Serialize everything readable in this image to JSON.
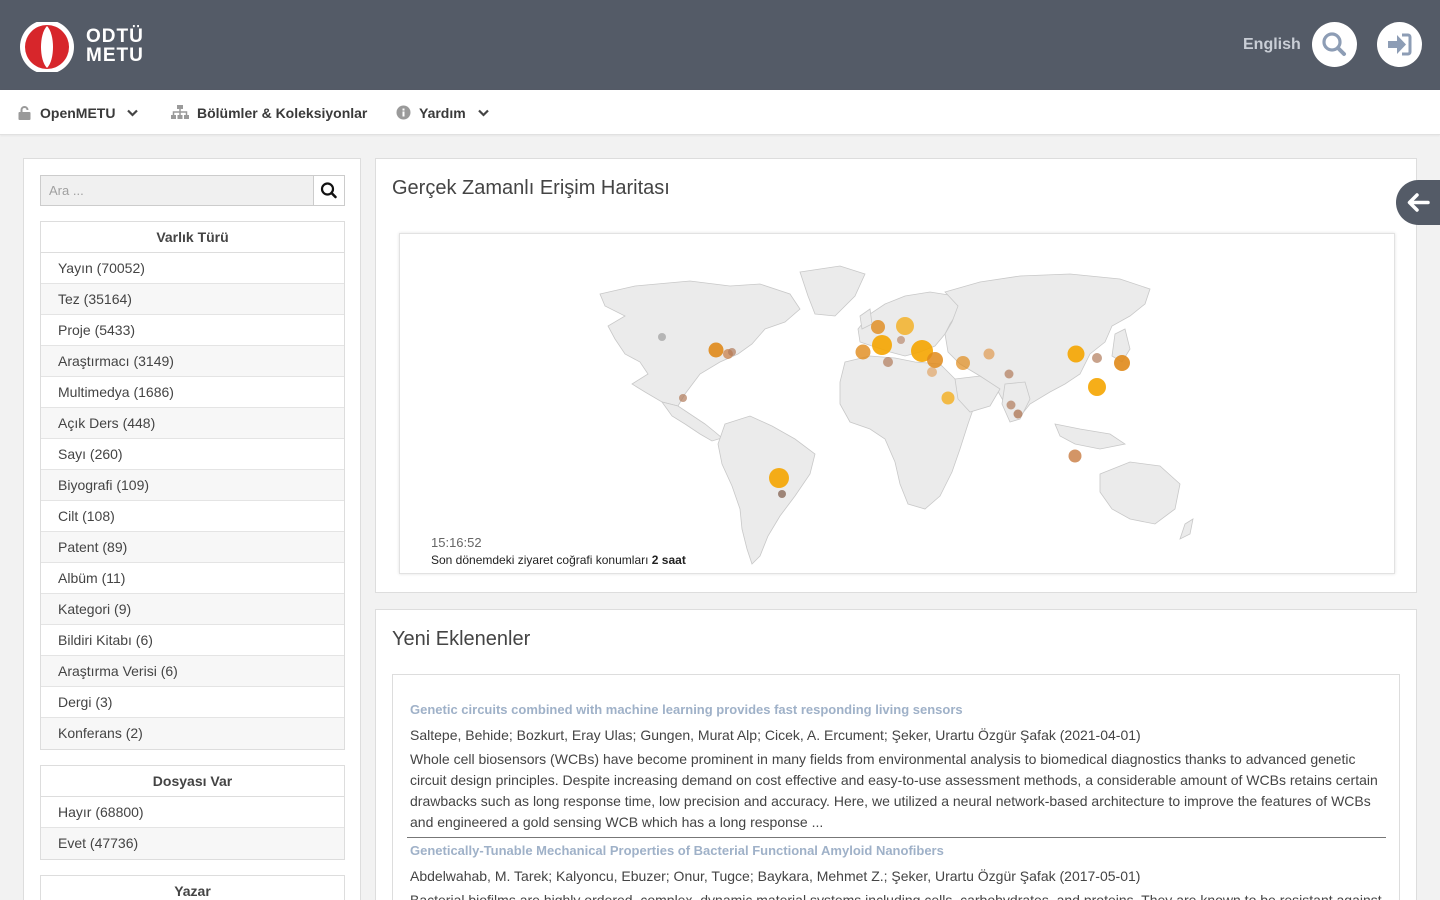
{
  "header": {
    "logo_line1": "ODTÜ",
    "logo_line2": "METU",
    "language_link": "English"
  },
  "nav": [
    {
      "label": "OpenMETU",
      "icon": "lock-icon",
      "has_dropdown": true
    },
    {
      "label": "Bölümler & Koleksiyonlar",
      "icon": "sitemap-icon",
      "has_dropdown": false
    },
    {
      "label": "Yardım",
      "icon": "info-icon",
      "has_dropdown": true
    }
  ],
  "sidebar": {
    "search_placeholder": "Ara ...",
    "facets": [
      {
        "title": "Varlık Türü",
        "items": [
          "Yayın (70052)",
          "Tez (35164)",
          "Proje (5433)",
          "Araştırmacı (3149)",
          "Multimedya (1686)",
          "Açık Ders (448)",
          "Sayı (260)",
          "Biyografi (109)",
          "Cilt (108)",
          "Patent (89)",
          "Albüm (11)",
          "Kategori (9)",
          "Bildiri Kitabı (6)",
          "Araştırma Verisi (6)",
          "Dergi (3)",
          "Konferans (2)"
        ]
      },
      {
        "title": "Dosyası Var",
        "items": [
          "Hayır (68800)",
          "Evet (47736)"
        ]
      },
      {
        "title": "Yazar",
        "items": []
      }
    ]
  },
  "map_panel": {
    "title": "Gerçek Zamanlı Erişim Haritası",
    "time": "15:16:52",
    "caption_prefix": "Son dönemdeki ziyaret coğrafi konumları",
    "caption_bold": "2 saat"
  },
  "recent_panel": {
    "title": "Yeni Eklenenler",
    "items": [
      {
        "title": "Genetic circuits combined with machine learning provides fast responding living sensors",
        "authors": "Saltepe, Behide; Bozkurt, Eray Ulas; Gungen, Murat Alp; Cicek, A. Ercument; Şeker, Urartu Özgür Şafak (2021-04-01)",
        "abstract": "Whole cell biosensors (WCBs) have become prominent in many fields from environmental analysis to biomedical diagnostics thanks to advanced genetic circuit design principles. Despite increasing demand on cost effective and easy-to-use assessment methods, a considerable amount of WCBs retains certain drawbacks such as long response time, low precision and accuracy. Here, we utilized a neural network-based architecture to improve the features of WCBs and engineered a gold sensing WCB which has a long response ..."
      },
      {
        "title": "Genetically-Tunable Mechanical Properties of Bacterial Functional Amyloid Nanofibers",
        "authors": "Abdelwahab, M. Tarek; Kalyoncu, Ebuzer; Onur, Tugce; Baykara, Mehmet Z.; Şeker, Urartu Özgür Şafak (2017-05-01)",
        "abstract": "Bacterial biofilms are highly ordered, complex, dynamic material systems including cells, carbohydrates, and proteins. They are known to be resistant against"
      }
    ]
  },
  "colors": {
    "header_bg": "#545b67",
    "link_title": "#9fb1c8",
    "marker_primary": "#f5a500",
    "marker_secondary": "#e08a1a",
    "marker_muted": "#b07a5a"
  }
}
